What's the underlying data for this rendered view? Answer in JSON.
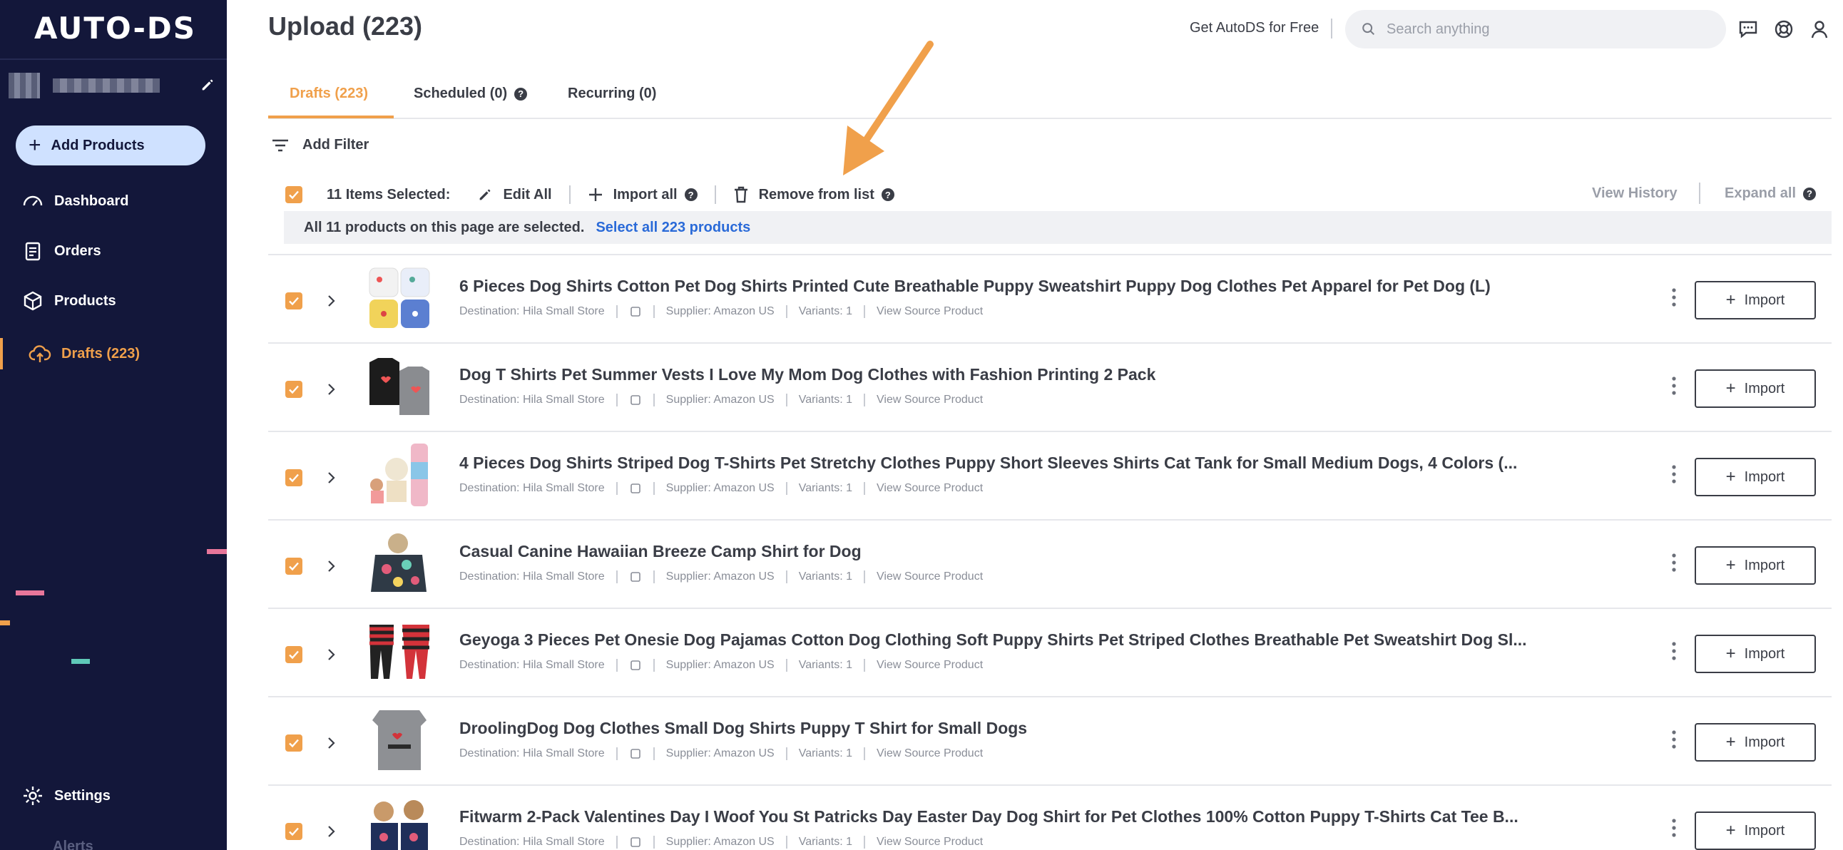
{
  "sidebar": {
    "logo": "AUTO-DS",
    "add_products_label": "Add Products",
    "items": [
      {
        "label": "Dashboard",
        "icon": "gauge-icon"
      },
      {
        "label": "Orders",
        "icon": "clipboard-icon"
      },
      {
        "label": "Products",
        "icon": "box-icon"
      },
      {
        "label": "Drafts (223)",
        "icon": "cloud-upload-icon",
        "active": true
      }
    ],
    "settings_label": "Settings",
    "alerts_label": "Alerts"
  },
  "header": {
    "title": "Upload (223)",
    "get_free": "Get AutoDS for Free",
    "search_placeholder": "Search anything"
  },
  "tabs": [
    {
      "label": "Drafts (223)",
      "active": true
    },
    {
      "label": "Scheduled (0)",
      "help": true
    },
    {
      "label": "Recurring (0)"
    }
  ],
  "filter": {
    "add_filter_label": "Add Filter"
  },
  "bulk": {
    "selected_label": "11 Items Selected:",
    "edit_all": "Edit All",
    "import_all": "Import all",
    "remove": "Remove from list",
    "view_history": "View History",
    "expand_all": "Expand all",
    "banner_text": "All 11 products on this page are selected.",
    "banner_link": "Select all 223 products"
  },
  "colors": {
    "accent": "#f0a04b",
    "sidebar": "#13173a",
    "link": "#2a6ad8"
  },
  "rows": [
    {
      "title": "6 Pieces Dog Shirts Cotton Pet Dog Shirts Printed Cute Breathable Puppy Sweatshirt Puppy Dog Clothes Pet Apparel for Pet Dog (L)",
      "destination": "Destination: Hila Small Store",
      "supplier": "Supplier: Amazon US",
      "variants": "Variants: 1",
      "source": "View Source Product",
      "import": "Import"
    },
    {
      "title": "Dog T Shirts Pet Summer Vests I Love My Mom Dog Clothes with Fashion Printing 2 Pack",
      "destination": "Destination: Hila Small Store",
      "supplier": "Supplier: Amazon US",
      "variants": "Variants: 1",
      "source": "View Source Product",
      "import": "Import"
    },
    {
      "title": "4 Pieces Dog Shirts Striped Dog T-Shirts Pet Stretchy Clothes Puppy Short Sleeves Shirts Cat Tank for Small Medium Dogs, 4 Colors (...",
      "destination": "Destination: Hila Small Store",
      "supplier": "Supplier: Amazon US",
      "variants": "Variants: 1",
      "source": "View Source Product",
      "import": "Import"
    },
    {
      "title": "Casual Canine Hawaiian Breeze Camp Shirt for Dog",
      "destination": "Destination: Hila Small Store",
      "supplier": "Supplier: Amazon US",
      "variants": "Variants: 1",
      "source": "View Source Product",
      "import": "Import"
    },
    {
      "title": "Geyoga 3 Pieces Pet Onesie Dog Pajamas Cotton Dog Clothing Soft Puppy Shirts Pet Striped Clothes Breathable Pet Sweatshirt Dog Sl...",
      "destination": "Destination: Hila Small Store",
      "supplier": "Supplier: Amazon US",
      "variants": "Variants: 1",
      "source": "View Source Product",
      "import": "Import"
    },
    {
      "title": "DroolingDog Dog Clothes Small Dog Shirts Puppy T Shirt for Small Dogs",
      "destination": "Destination: Hila Small Store",
      "supplier": "Supplier: Amazon US",
      "variants": "Variants: 1",
      "source": "View Source Product",
      "import": "Import"
    },
    {
      "title": "Fitwarm 2-Pack Valentines Day I Woof You St Patricks Day Easter Day Dog Shirt for Pet Clothes 100% Cotton Puppy T-Shirts Cat Tee B...",
      "destination": "Destination: Hila Small Store",
      "supplier": "Supplier: Amazon US",
      "variants": "Variants: 1",
      "source": "View Source Product",
      "import": "Import"
    }
  ]
}
